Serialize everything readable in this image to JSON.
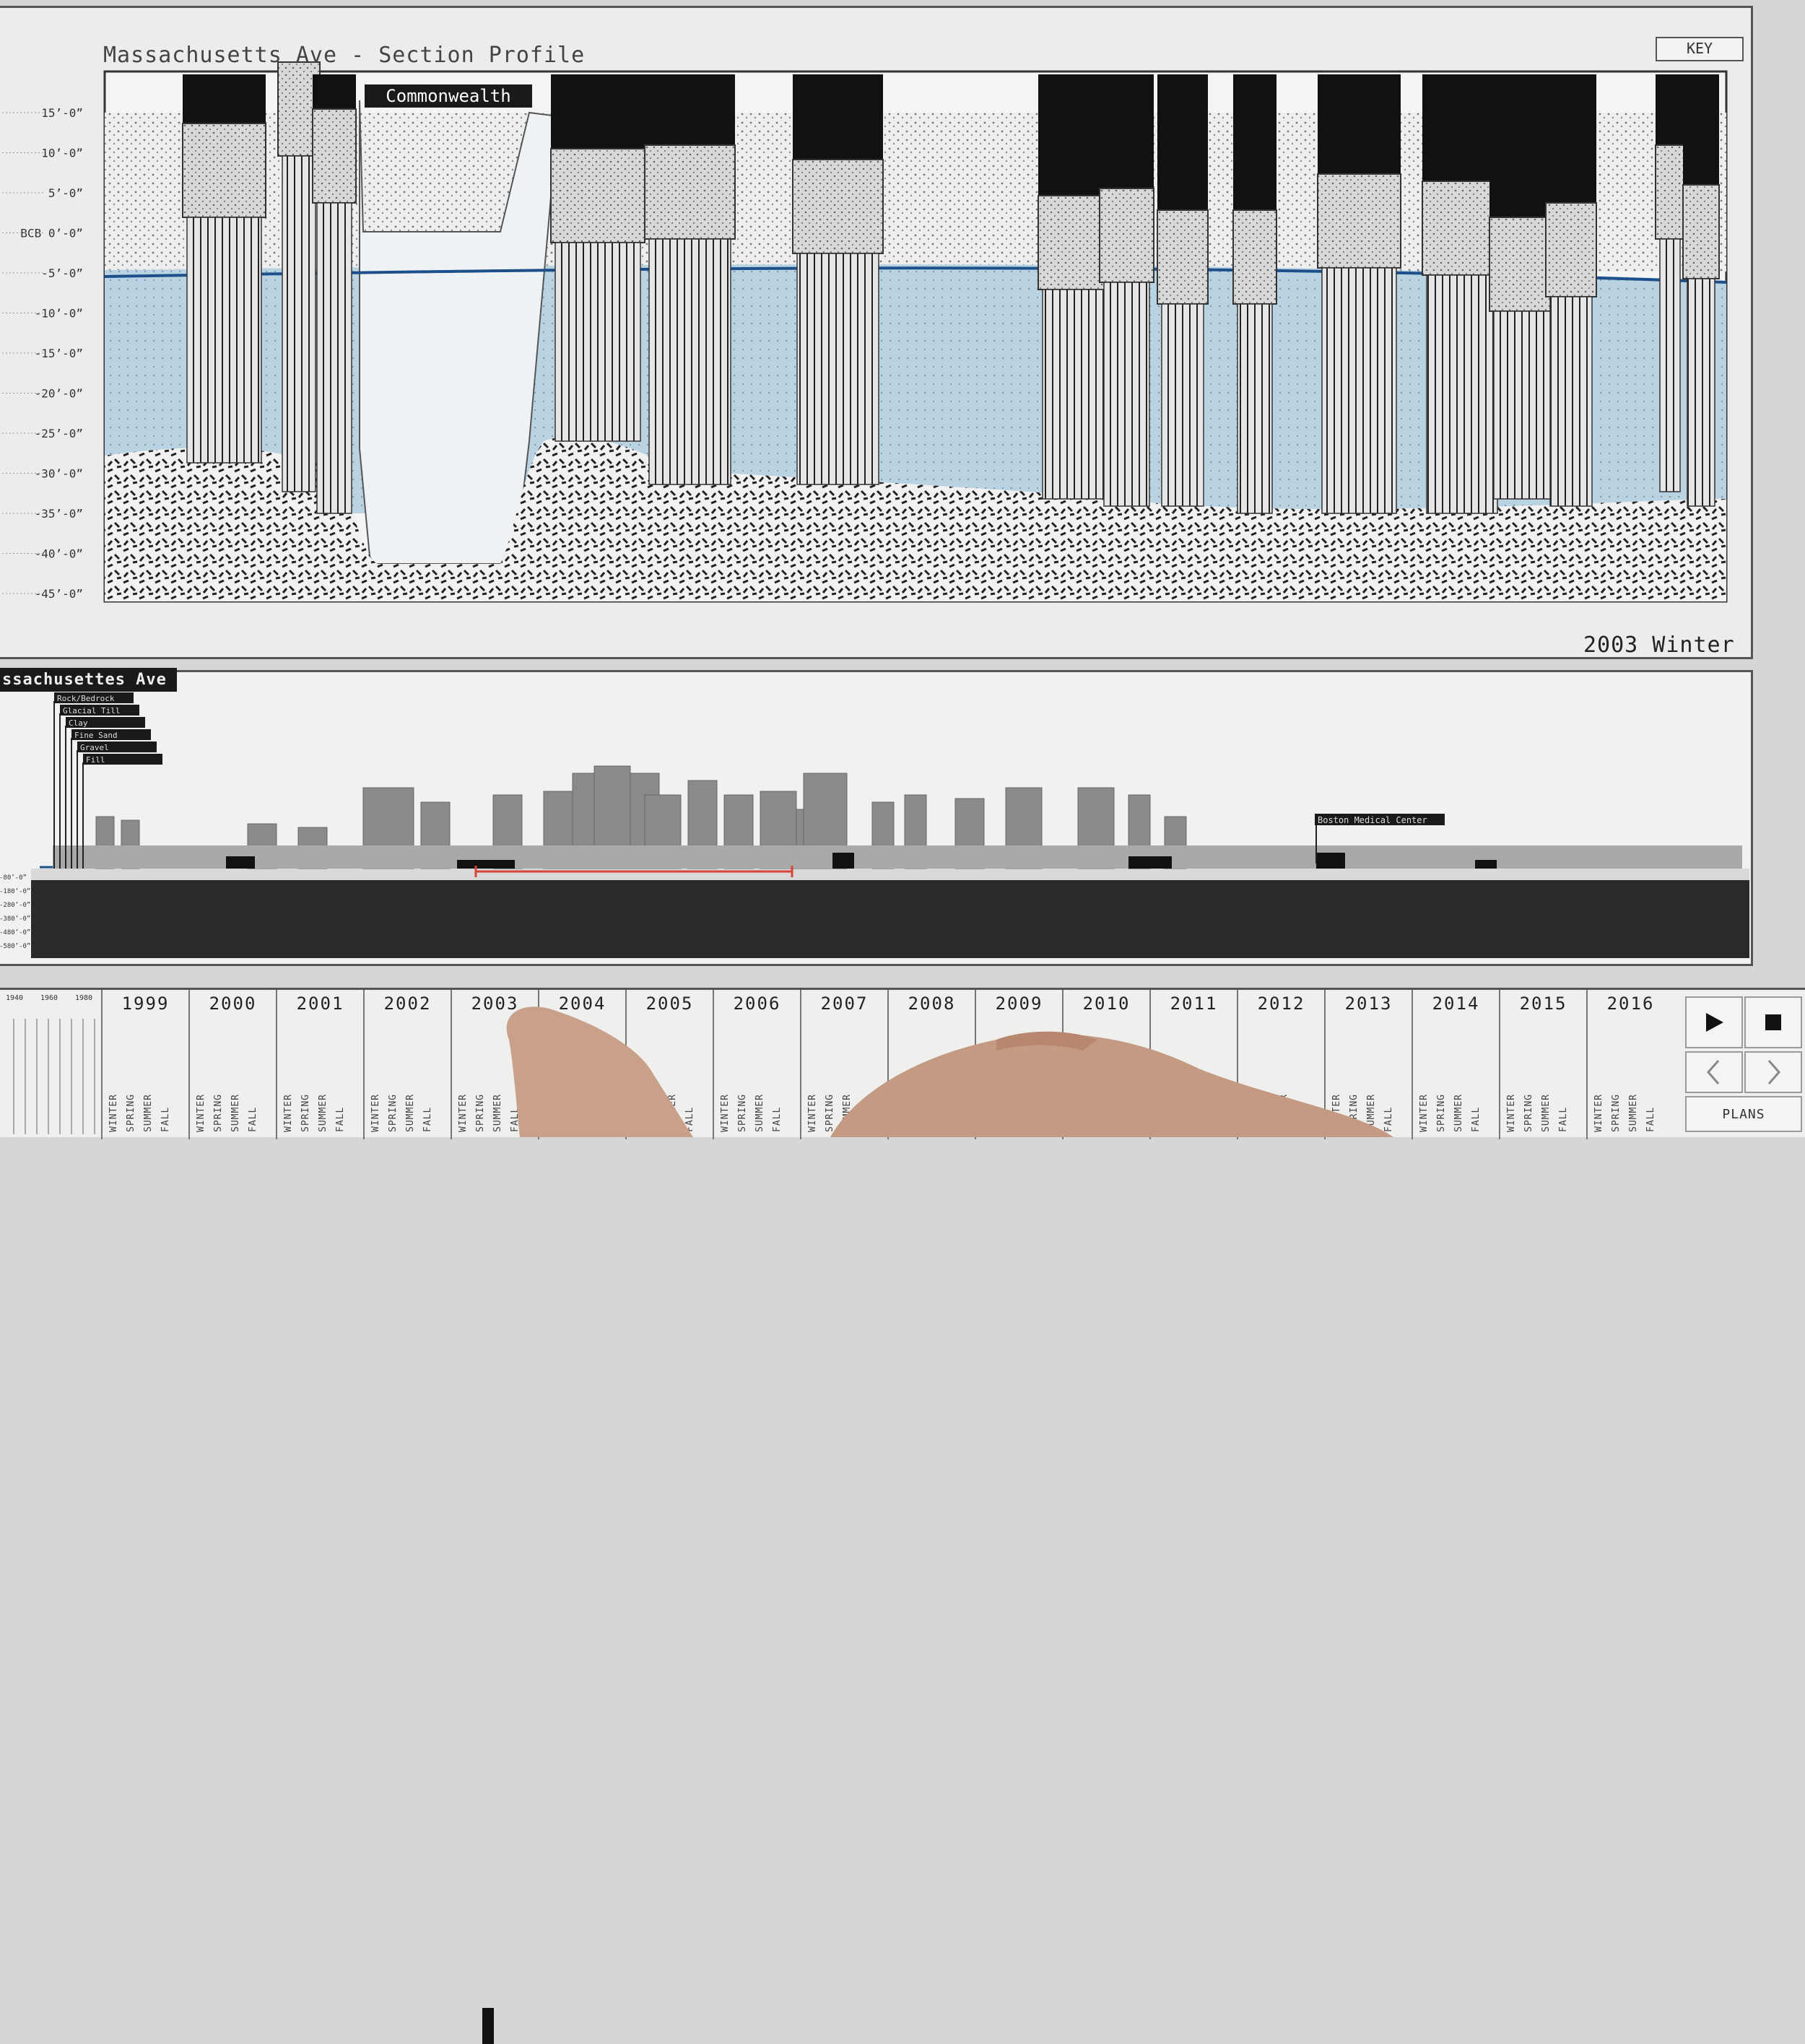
{
  "section": {
    "title": "Massachusetts Ave - Section Profile",
    "key_label": "KEY",
    "callout": "Commonwealth",
    "season_label": "2003 Winter",
    "y_axis": [
      "15’-0”",
      "10’-0”",
      "5’-0”",
      "BCB 0’-0”",
      "-5’-0”",
      "-10’-0”",
      "-15’-0”",
      "-20’-0”",
      "-25’-0”",
      "-30’-0”",
      "-35’-0”",
      "-40’-0”",
      "-45’-0”"
    ]
  },
  "skyline": {
    "tab_label": "ssachusettes Ave",
    "legend": [
      "Rock/Bedrock",
      "Glacial Till",
      "Clay",
      "Fine Sand",
      "Gravel",
      "Fill"
    ],
    "landmark": "Boston Medical Center",
    "depth_axis": [
      "-80’-0”",
      "-180’-0”",
      "-280’-0”",
      "-380’-0”",
      "-480’-0”",
      "-580’-0”"
    ]
  },
  "timeline": {
    "old_years": [
      "1940",
      "1960",
      "1980"
    ],
    "years": [
      "1999",
      "2000",
      "2001",
      "2002",
      "2003",
      "2004",
      "2005",
      "2006",
      "2007",
      "2008",
      "2009",
      "2010",
      "2011",
      "2012",
      "2013",
      "2014",
      "2015",
      "2016"
    ],
    "seasons": [
      "WINTER",
      "SPRING",
      "SUMMER",
      "FALL"
    ],
    "plans_label": "PLANS",
    "selected_year": "2003",
    "selected_season": "WINTER"
  },
  "colors": {
    "water": "#b9d3e3",
    "water_line": "#1d4f8a",
    "building": "#111111",
    "panel_bg": "#ececea",
    "selection": "#d8453a"
  }
}
